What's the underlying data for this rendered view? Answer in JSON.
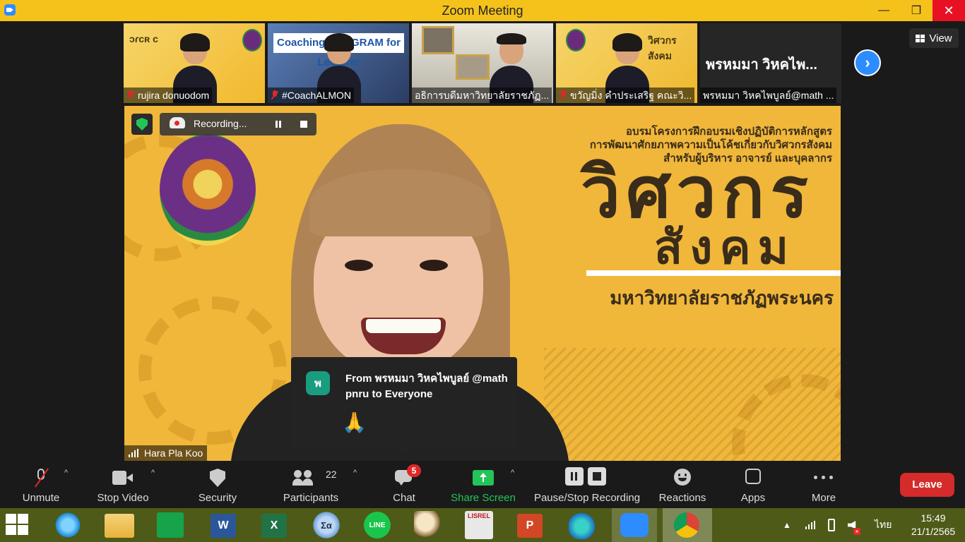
{
  "window": {
    "title": "Zoom Meeting",
    "controls": {
      "minimize": "—",
      "maximize": "❐",
      "close": "✕"
    }
  },
  "gallery": {
    "tiles": [
      {
        "name": "rujira donuodom",
        "muted": true,
        "sign": "ᴐɾᴄʀ ᴄ"
      },
      {
        "name": "#CoachALMON",
        "muted": true,
        "banner": "Coaching PROGRAM for Lecturer"
      },
      {
        "name": "อธิการบดีมหาวิทยาลัยราชภัฏ...",
        "muted": false
      },
      {
        "name": "ขวัญมิ่ง คำประเสริฐ คณะวิ...",
        "muted": true,
        "sign": "วิศวกร สังคม"
      },
      {
        "name": "พรหมมา วิหคไพบูลย์@math ...",
        "muted": false,
        "big_name": "พรหมมา วิหคไพ..."
      }
    ],
    "next_icon": "chevron-right-icon",
    "view_label": "View"
  },
  "main_video": {
    "recording_label": "Recording...",
    "backdrop": {
      "line1": "อบรมโครงการฝึกอบรมเชิงปฏิบัติการหลักสูตร",
      "line2": "การพัฒนาศักยภาพความเป็นโค้ชเกี่ยวกับวิศวกรสังคม",
      "line3": "สำหรับผู้บริหาร อาจารย์ และบุคลากร",
      "big1": "วิศวกร",
      "big2": "สังคม",
      "university": "มหาวิทยาลัยราชภัฏพระนคร"
    },
    "speaker_name": "Hara Pla Koo"
  },
  "chat_popup": {
    "avatar_letter": "พ",
    "from": "From พรหมมา วิหคไพบูลย์ @math pnru to Everyone",
    "message": "🙏"
  },
  "toolbar": {
    "unmute": "Unmute",
    "stop_video": "Stop Video",
    "security": "Security",
    "participants": "Participants",
    "participants_count": "22",
    "chat": "Chat",
    "chat_badge": "5",
    "share_screen": "Share Screen",
    "pause_stop_recording": "Pause/Stop Recording",
    "reactions": "Reactions",
    "apps": "Apps",
    "more": "More",
    "leave": "Leave",
    "caret": "^"
  },
  "taskbar": {
    "word_glyph": "W",
    "excel_glyph": "X",
    "calc_glyph": "Σα",
    "line_glyph": "LINE",
    "ppt_glyph": "P",
    "lisrel_glyph": "LISREL",
    "tray_up": "▲",
    "language": "ไทย",
    "time": "15:49",
    "date": "21/1/2565",
    "volume_mute_glyph": "×"
  },
  "colors": {
    "title_bar": "#f5c21b",
    "zoom_blue": "#2d8cff",
    "share_green": "#23c45a",
    "leave_red": "#d52b2b",
    "taskbar": "#4e5a17"
  }
}
